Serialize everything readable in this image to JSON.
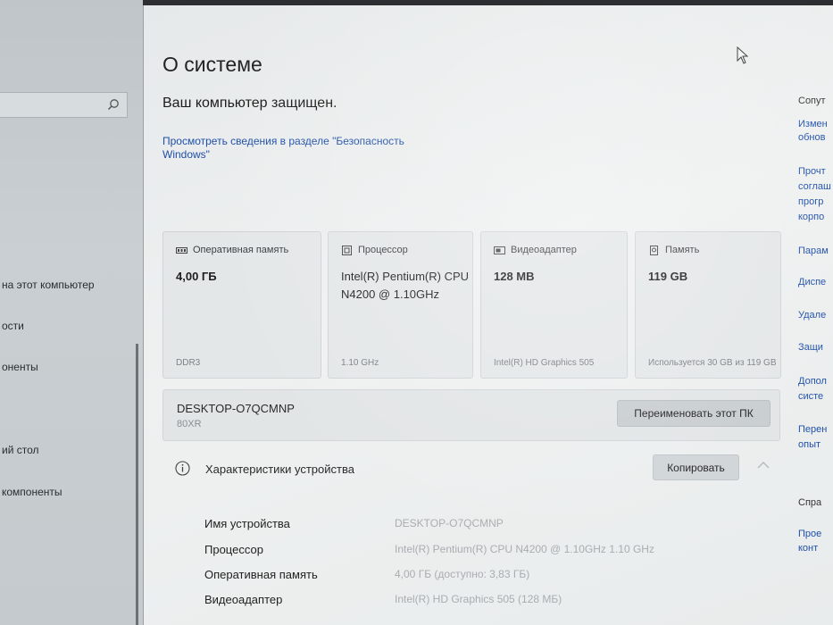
{
  "left_pane": {
    "search_placeholder": "",
    "items": [
      {
        "label": "на этот компьютер"
      },
      {
        "label": "ости"
      },
      {
        "label": "оненты"
      },
      {
        "label": "ий стол"
      },
      {
        "label": "компоненты"
      }
    ]
  },
  "main": {
    "title": "О системе",
    "protected_text": "Ваш компьютер защищен.",
    "security_link": "Просмотреть сведения в разделе \"Безопасность Windows\"",
    "cards": [
      {
        "icon": "ram-icon",
        "label": "Оперативная память",
        "value": "4,00 ГБ",
        "sub": "DDR3"
      },
      {
        "icon": "processor-icon",
        "label": "Процессор",
        "value": "Intel(R) Pentium(R) CPU N4200 @ 1.10GHz",
        "sub": "1.10 GHz"
      },
      {
        "icon": "video-adapter-icon",
        "label": "Видеоадаптер",
        "value": "128 MB",
        "sub": "Intel(R) HD Graphics 505"
      },
      {
        "icon": "storage-icon",
        "label": "Память",
        "value": "119 GB",
        "sub": "Используется 30 GB из 119 GB"
      }
    ],
    "pc": {
      "name": "DESKTOP-O7QCMNP",
      "model": "80XR",
      "rename_label": "Переименовать этот ПК"
    },
    "specs": {
      "title": "Характеристики устройства",
      "copy_label": "Копировать",
      "rows": [
        {
          "label": "Имя устройства",
          "value": "DESKTOP-O7QCMNP"
        },
        {
          "label": "Процессор",
          "value": "Intel(R) Pentium(R) CPU N4200 @ 1.10GHz   1.10 GHz"
        },
        {
          "label": "Оперативная память",
          "value": "4,00 ГБ (доступно: 3,83 ГБ)"
        },
        {
          "label": "Видеоадаптер",
          "value": "Intel(R) HD Graphics 505 (128 МБ)"
        }
      ]
    }
  },
  "right_pane": {
    "items": [
      {
        "label": "Сопут",
        "dark": true
      },
      {
        "label": "Измен"
      },
      {
        "label": "обнов"
      },
      {
        "label": "Прочт"
      },
      {
        "label": "соглаш"
      },
      {
        "label": "прогр"
      },
      {
        "label": "корпо"
      },
      {
        "label": "Парам"
      },
      {
        "label": "Диспе"
      },
      {
        "label": "Удале"
      },
      {
        "label": "Защи"
      },
      {
        "label": "Допол"
      },
      {
        "label": "систе"
      },
      {
        "label": "Перен"
      },
      {
        "label": "опыт"
      },
      {
        "label": "Спра",
        "dark": true
      },
      {
        "label": "Прое"
      },
      {
        "label": "конт"
      }
    ]
  },
  "colors": {
    "link": "#1f4fa8",
    "window_bg": "#eceff0",
    "card_bg": "#e4e7e8"
  }
}
